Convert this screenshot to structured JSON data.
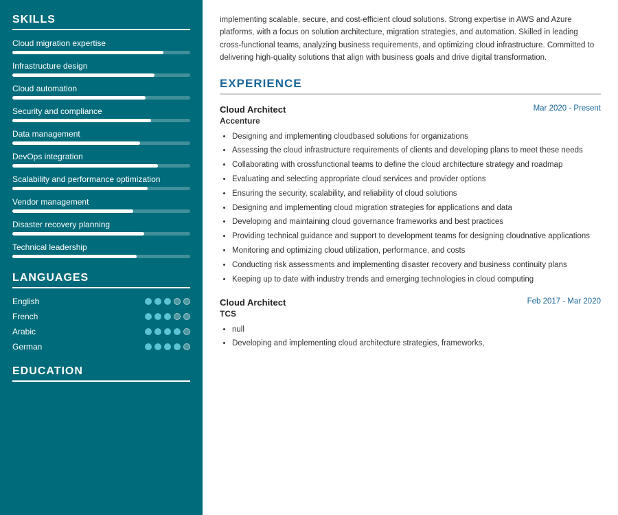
{
  "sidebar": {
    "skills_title": "SKILLS",
    "skills": [
      {
        "label": "Cloud migration expertise",
        "pct": 85
      },
      {
        "label": "Infrastructure design",
        "pct": 80
      },
      {
        "label": "Cloud automation",
        "pct": 75
      },
      {
        "label": "Security and compliance",
        "pct": 78
      },
      {
        "label": "Data management",
        "pct": 72
      },
      {
        "label": "DevOps integration",
        "pct": 82
      },
      {
        "label": "Scalability and performance optimization",
        "pct": 76
      },
      {
        "label": "Vendor management",
        "pct": 68
      },
      {
        "label": "Disaster recovery planning",
        "pct": 74
      },
      {
        "label": "Technical leadership",
        "pct": 70
      }
    ],
    "languages_title": "LANGUAGES",
    "languages": [
      {
        "name": "English",
        "filled": 3,
        "empty": 2
      },
      {
        "name": "French",
        "filled": 3,
        "empty": 2
      },
      {
        "name": "Arabic",
        "filled": 4,
        "empty": 1
      },
      {
        "name": "German",
        "filled": 4,
        "empty": 1
      }
    ],
    "education_title": "EDUCATION"
  },
  "main": {
    "summary": "implementing scalable, secure, and cost-efficient cloud solutions. Strong expertise in AWS and Azure platforms, with a focus on solution architecture, migration strategies, and automation. Skilled in leading cross-functional teams, analyzing business requirements, and optimizing cloud infrastructure. Committed to delivering high-quality solutions that align with business goals and drive digital transformation.",
    "experience_title": "EXPERIENCE",
    "jobs": [
      {
        "title": "Cloud Architect",
        "date": "Mar 2020 - Present",
        "company": "Accenture",
        "bullets": [
          "Designing and implementing cloudbased solutions for organizations",
          "Assessing the cloud infrastructure requirements of clients and developing plans to meet these needs",
          "Collaborating with crossfunctional teams to define the cloud architecture strategy and roadmap",
          "Evaluating and selecting appropriate cloud services and provider options",
          "Ensuring the security, scalability, and reliability of cloud solutions",
          "Designing and implementing cloud migration strategies for applications and data",
          "Developing and maintaining cloud governance frameworks and best practices",
          "Providing technical guidance and support to development teams for designing cloudnative applications",
          "Monitoring and optimizing cloud utilization, performance, and costs",
          "Conducting risk assessments and implementing disaster recovery and business continuity plans",
          "Keeping up to date with industry trends and emerging technologies in cloud computing"
        ]
      },
      {
        "title": "Cloud Architect",
        "date": "Feb 2017 - Mar 2020",
        "company": "TCS",
        "bullets": [
          "null",
          "Developing and implementing cloud architecture strategies, frameworks,"
        ]
      }
    ]
  }
}
